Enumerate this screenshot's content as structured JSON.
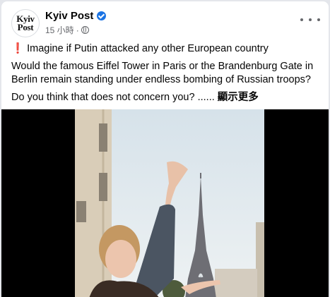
{
  "header": {
    "page_name": "Kyiv Post",
    "time": "15 小時",
    "dot": "·"
  },
  "post": {
    "line1_icon": "❗",
    "line1": "Imagine if Putin attacked any other European country",
    "line2": "Would the famous Eiffel Tower in Paris or the Brandenburg Gate in Berlin remain standing under endless bombing of Russian troops?",
    "line3": "Do you think that does not concern you? ...... ",
    "see_more": "顯示更多"
  },
  "icons": [
    "kyiv-post-logo",
    "verified-badge-icon",
    "globe-icon",
    "more-options-icon",
    "exclamation-icon"
  ],
  "colors": {
    "verified": "#1b74e4",
    "secondary_text": "#65676b",
    "exclamation": "#dd2e44"
  }
}
